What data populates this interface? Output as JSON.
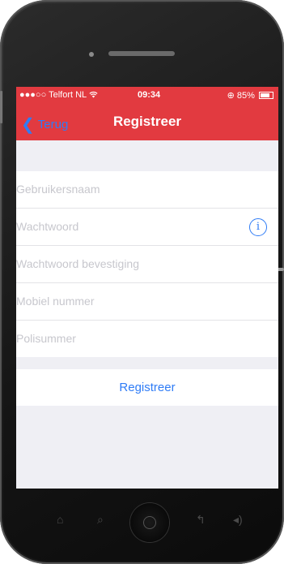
{
  "status_bar": {
    "carrier": "●●●○○ Telfort NL",
    "wifi_icon": "wifi-icon",
    "time": "09:34",
    "battery": "85%"
  },
  "nav": {
    "back_label": "Terug",
    "title": "Registreer"
  },
  "form": {
    "fields": [
      {
        "placeholder": "Gebruikersnaam",
        "value": ""
      },
      {
        "placeholder": "Wachtwoord",
        "value": ""
      },
      {
        "placeholder": "Wachtwoord bevestiging",
        "value": ""
      },
      {
        "placeholder": "Mobiel nummer",
        "value": ""
      },
      {
        "placeholder": "Polisummer",
        "value": ""
      }
    ],
    "info_icon": "i",
    "submit_label": "Registreer"
  },
  "colors": {
    "accent": "#e23a40",
    "link": "#2f7cf6",
    "background": "#efeff4"
  }
}
